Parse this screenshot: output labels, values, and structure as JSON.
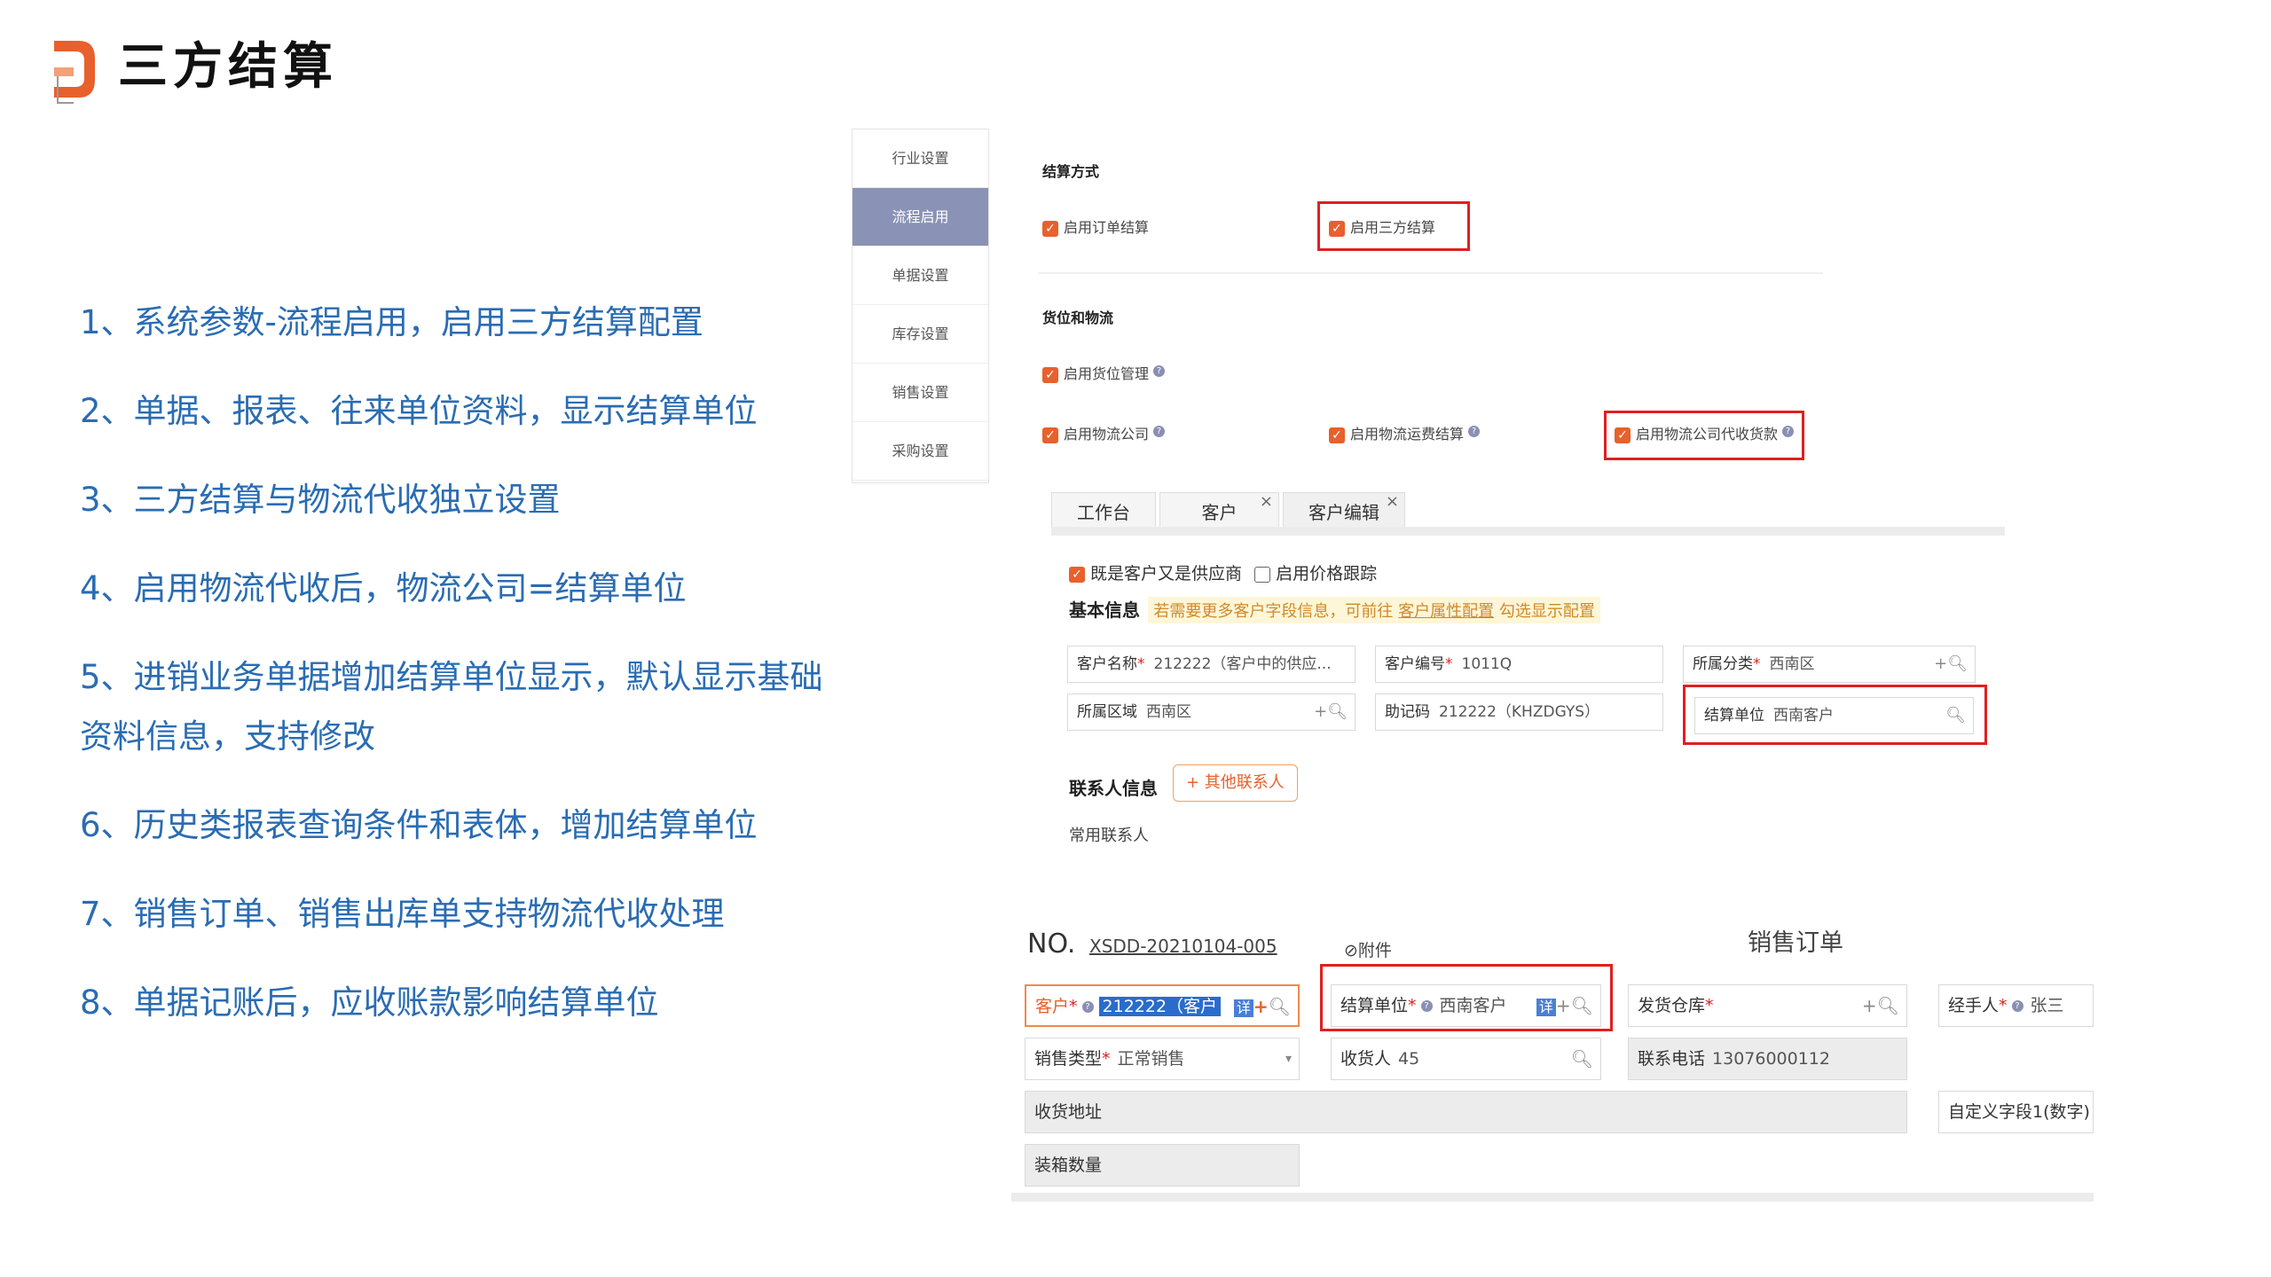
{
  "slide": {
    "title": "三方结算",
    "bullets": [
      "1、系统参数-流程启用，启用三方结算配置",
      "2、单据、报表、往来单位资料，显示结算单位",
      "3、三方结算与物流代收独立设置",
      "4、启用物流代收后，物流公司=结算单位",
      "5、进销业务单据增加结算单位显示，默认显示基础资料信息，支持修改",
      "6、历史类报表查询条件和表体，增加结算单位",
      "7、销售订单、销售出库单支持物流代收处理",
      "8、单据记账后，应收账款影响结算单位"
    ]
  },
  "settings": {
    "nav": [
      "行业设置",
      "流程启用",
      "单据设置",
      "库存设置",
      "销售设置",
      "采购设置"
    ],
    "active_nav": "流程启用",
    "section1_title": "结算方式",
    "opt_order_settle": "启用订单结算",
    "opt_three_party": "启用三方结算",
    "section2_title": "货位和物流",
    "opt_location": "启用货位管理",
    "opt_logistics": "启用物流公司",
    "opt_freight": "启用物流运费结算",
    "opt_cod": "启用物流公司代收货款"
  },
  "customer": {
    "tabs": [
      "工作台",
      "客户",
      "客户编辑"
    ],
    "both_label": "既是客户又是供应商",
    "price_track_label": "启用价格跟踪",
    "basic_info": "基本信息",
    "hint_pre": "若需要更多客户字段信息，可前往",
    "hint_link": "客户属性配置",
    "hint_post": "勾选显示配置",
    "fields": {
      "name_key": "客户名称",
      "name_val": "212222（客户中的供应...",
      "code_key": "客户编号",
      "code_val": "1011Q",
      "category_key": "所属分类",
      "category_val": "西南区",
      "region_key": "所属区域",
      "region_val": "西南区",
      "mnemonic_key": "助记码",
      "mnemonic_val": "212222（KHZDGYS）",
      "settle_key": "结算单位",
      "settle_val": "西南客户"
    },
    "contact_info": "联系人信息",
    "other_contact_btn": "+ 其他联系人",
    "common_contact": "常用联系人"
  },
  "order": {
    "no_label": "NO.",
    "no_value": "XSDD-20210104-005",
    "attach": "附件",
    "title": "销售订单",
    "customer_key": "客户",
    "customer_val": "212222（客户",
    "detail_btn": "详",
    "settle_key": "结算单位",
    "settle_val": "西南客户",
    "warehouse_key": "发货仓库",
    "handler_key": "经手人",
    "handler_val": "张三",
    "sale_type_key": "销售类型",
    "sale_type_val": "正常销售",
    "receiver_key": "收货人",
    "receiver_val": "45",
    "phone_key": "联系电话",
    "phone_val": "13076000112",
    "address_key": "收货地址",
    "custom_key": "自定义字段1(数字)",
    "boxes_key": "装箱数量"
  },
  "colors": {
    "accent": "#e8602c",
    "bullet_blue": "#2a6cb3",
    "highlight_red": "#e02020",
    "nav_active": "#8a93b5"
  }
}
